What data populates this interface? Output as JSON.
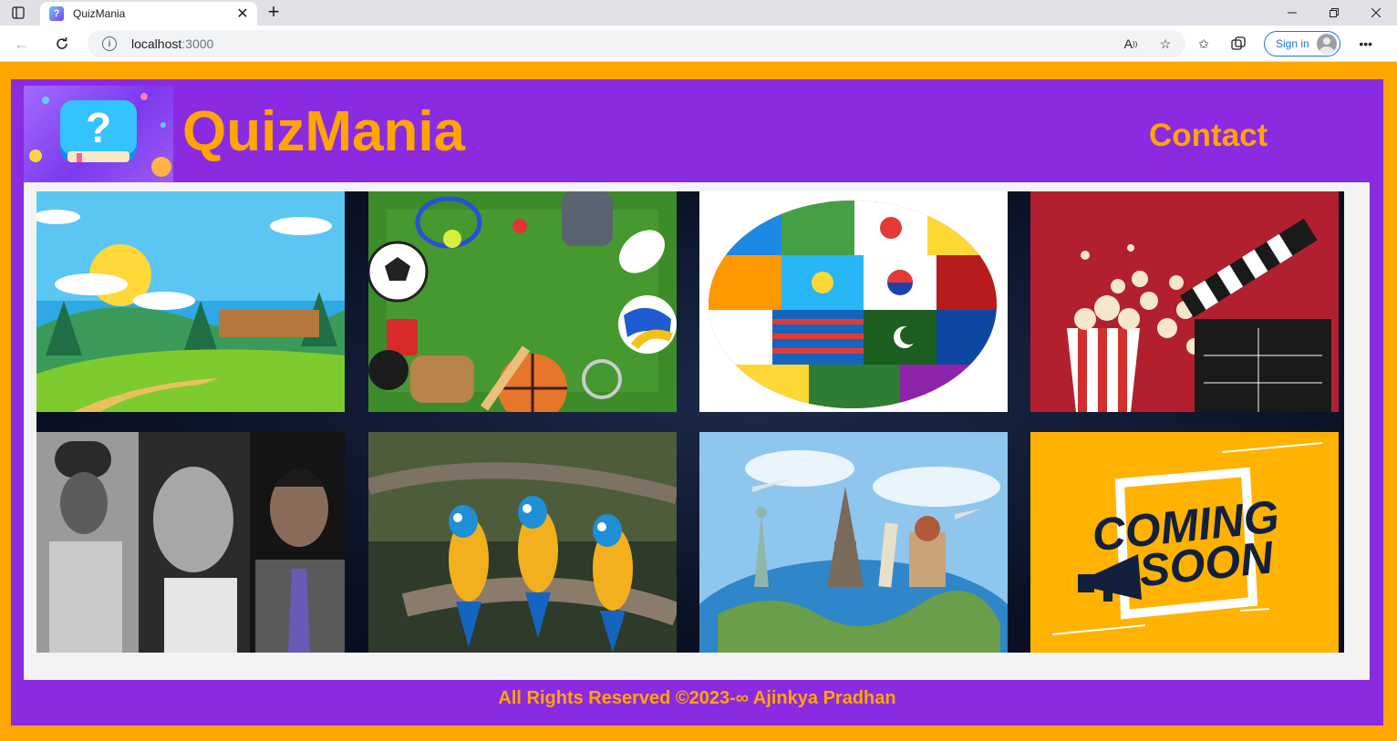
{
  "browser": {
    "tab_title": "QuizMania",
    "url_host": "localhost",
    "url_port": ":3000",
    "sign_in_label": "Sign in"
  },
  "header": {
    "brand": "QuizMania",
    "contact_label": "Contact"
  },
  "cards": [
    {
      "topic": "nature",
      "icon": "landscape-image"
    },
    {
      "topic": "sports",
      "icon": "sports-equipment-image"
    },
    {
      "topic": "flags",
      "icon": "world-flags-image"
    },
    {
      "topic": "movies",
      "icon": "popcorn-clapperboard-image"
    },
    {
      "topic": "famous-people",
      "icon": "portraits-image"
    },
    {
      "topic": "animals",
      "icon": "parrots-image"
    },
    {
      "topic": "travel",
      "icon": "world-landmarks-image"
    },
    {
      "topic": "coming-soon",
      "icon": "coming-soon-image",
      "text_line1": "COMING",
      "text_line2": "SOON"
    }
  ],
  "footer": {
    "text": "All Rights Reserved ©2023-∞ Ajinkya Pradhan"
  },
  "colors": {
    "page_bg": "#ffa500",
    "frame_bg": "#8a2be2",
    "accent_text": "#ffa500"
  }
}
